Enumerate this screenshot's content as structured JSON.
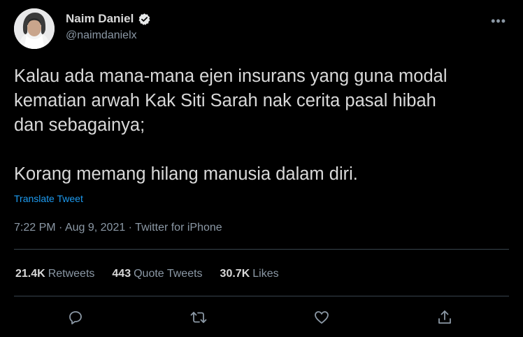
{
  "user": {
    "display_name": "Naim Daniel",
    "handle": "@naimdanielx",
    "verified": true
  },
  "tweet": {
    "text": "Kalau ada mana-mana ejen insurans yang guna modal\nkematian arwah Kak Siti Sarah nak cerita pasal hibah\ndan sebagainya;\n\nKorang memang hilang manusia dalam diri.",
    "translate_label": "Translate Tweet",
    "time": "7:22 PM",
    "date": "Aug 9, 2021",
    "source": "Twitter for iPhone",
    "separator": " · "
  },
  "stats": {
    "retweets_count": "21.4K",
    "retweets_label": "Retweets",
    "quotes_count": "443",
    "quotes_label": "Quote Tweets",
    "likes_count": "30.7K",
    "likes_label": "Likes"
  },
  "actions": [
    "reply-icon",
    "retweet-icon",
    "like-icon",
    "share-icon"
  ],
  "colors": {
    "background": "#000000",
    "text": "#d9d9d9",
    "muted": "#8b98a5",
    "link": "#1d9bf0",
    "divider": "#38444d"
  }
}
